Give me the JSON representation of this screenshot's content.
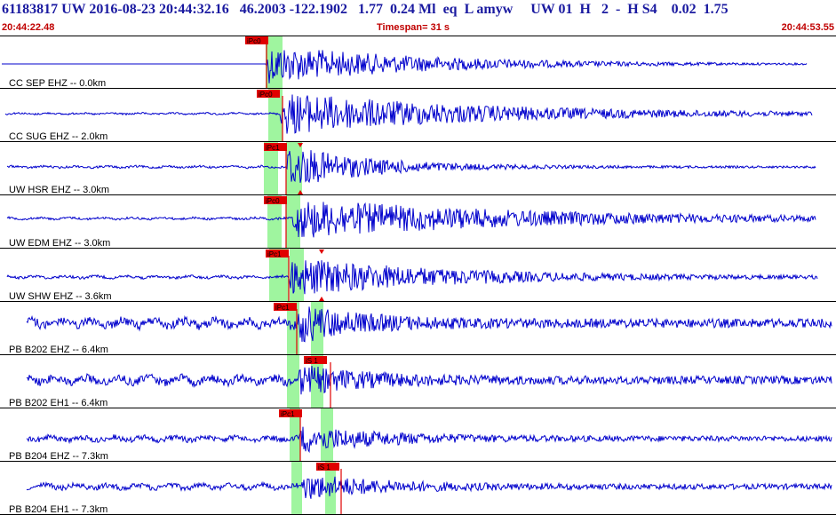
{
  "header": {
    "event_line": "61183817 UW 2016-08-23 20:44:32.16   46.2003 -122.1902   1.77  0.24 Ml  eq  L amyw     UW 01  H   2  -  H S4    0.02  1.75",
    "start_time": "20:44:22.48",
    "timespan": "Timespan=  31 s",
    "end_time": "20:44:53.55"
  },
  "colors": {
    "trace": "#0000cc",
    "pick": "#e00000",
    "pick_window": "#9ff59f",
    "separator": "#000000",
    "header_text": "#1a1aa0",
    "header_time": "#c00000"
  },
  "channels": [
    {
      "label": "CC SEP EHZ -- 0.0km",
      "picks": [
        {
          "label": "iPc0"
        }
      ]
    },
    {
      "label": "CC SUG EHZ -- 2.0km",
      "picks": [
        {
          "label": "iPc0"
        }
      ]
    },
    {
      "label": "UW HSR EHZ -- 3.0km",
      "picks": [
        {
          "label": "iPc1"
        }
      ]
    },
    {
      "label": "UW EDM EHZ -- 3.0km",
      "picks": [
        {
          "label": "iPc0"
        }
      ]
    },
    {
      "label": "UW SHW EHZ -- 3.6km",
      "picks": [
        {
          "label": "iPc1"
        }
      ]
    },
    {
      "label": "PB B202 EHZ -- 6.4km",
      "picks": [
        {
          "label": "iPc1"
        }
      ]
    },
    {
      "label": "PB B202 EH1 -- 6.4km",
      "picks": [
        {
          "label": "iS 1"
        }
      ]
    },
    {
      "label": "PB B204 EHZ -- 7.3km",
      "picks": [
        {
          "label": "iPc1"
        }
      ]
    },
    {
      "label": "PB B204 EH1 -- 7.3km",
      "picks": [
        {
          "label": "iS 1"
        }
      ]
    }
  ]
}
